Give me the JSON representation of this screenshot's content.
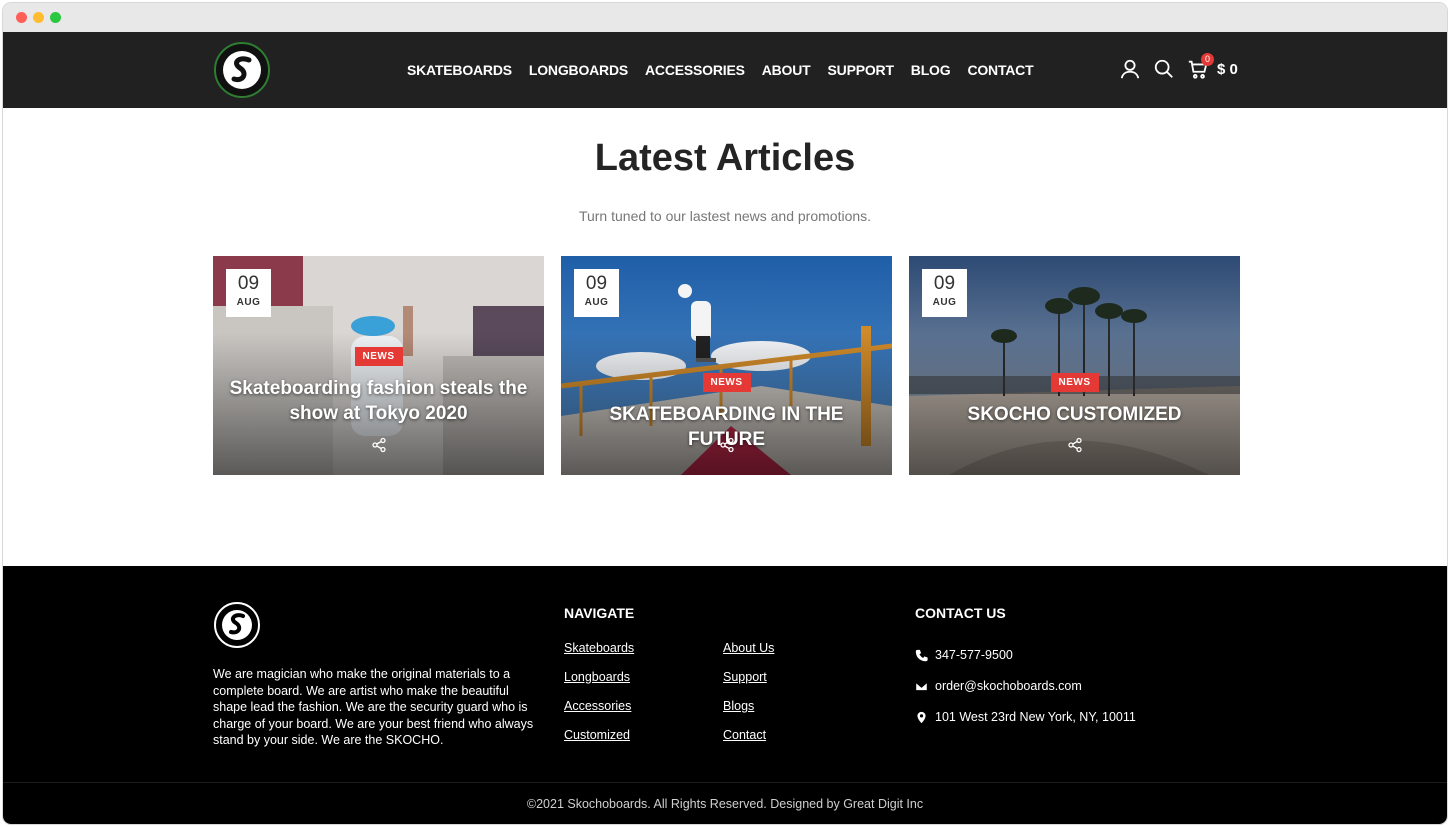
{
  "nav": {
    "items": [
      "SKATEBOARDS",
      "LONGBOARDS",
      "ACCESSORIES",
      "ABOUT",
      "SUPPORT",
      "BLOG",
      "CONTACT"
    ]
  },
  "header": {
    "cart_count": "0",
    "cart_total": "$ 0",
    "icons": [
      "user-icon",
      "search-icon",
      "cart-icon"
    ]
  },
  "section": {
    "title": "Latest Articles",
    "subtitle": "Turn tuned to our lastest news and promotions."
  },
  "articles": [
    {
      "day": "09",
      "month": "AUG",
      "tag": "NEWS",
      "title": "Skateboarding fashion steals the show at Tokyo 2020"
    },
    {
      "day": "09",
      "month": "AUG",
      "tag": "NEWS",
      "title": "SKATEBOARDING IN THE FUTURE"
    },
    {
      "day": "09",
      "month": "AUG",
      "tag": "NEWS",
      "title": "SKOCHO CUSTOMIZED"
    }
  ],
  "footer": {
    "about": "We are magician who make the original materials to a complete board. We are artist who make the beautiful shape lead the fashion. We are the security guard who is charge of your board. We are your best friend who always stand by your side. We are the SKOCHO.",
    "navigate_heading": "NAVIGATE",
    "navigate_col1": [
      "Skateboards",
      "Longboards",
      "Accessories",
      "Customized"
    ],
    "navigate_col2": [
      "About Us",
      "Support",
      "Blogs",
      "Contact"
    ],
    "contact_heading": "CONTACT US",
    "phone": "347-577-9500",
    "email": "order@skochoboards.com",
    "address": "101 West 23rd New York, NY, 10011",
    "copyright": "©2021 Skochoboards. All Rights Reserved. Designed by Great Digit Inc"
  },
  "colors": {
    "accent": "#e53935",
    "header_bg": "#212121",
    "footer_bg": "#000000"
  }
}
